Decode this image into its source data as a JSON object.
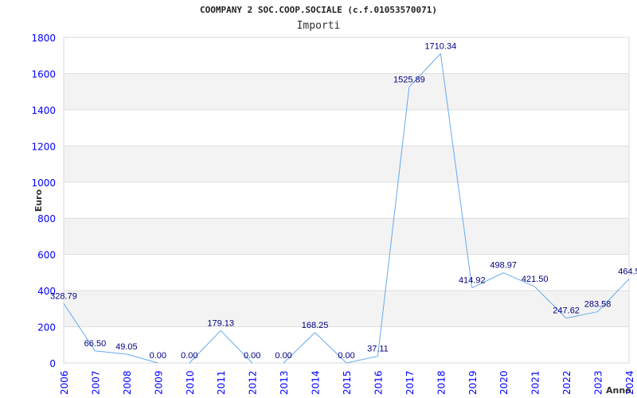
{
  "chart_data": {
    "type": "line",
    "title": "COOMPANY 2 SOC.COOP.SOCIALE (c.f.01053570071)",
    "subtitle": "Importi",
    "xlabel": "Anno",
    "ylabel": "Euro",
    "ylim": [
      0,
      1800
    ],
    "yticks": [
      0,
      200,
      400,
      600,
      800,
      1000,
      1200,
      1400,
      1600,
      1800
    ],
    "grid": true,
    "categories": [
      "2006",
      "2007",
      "2008",
      "2009",
      "2010",
      "2011",
      "2012",
      "2013",
      "2014",
      "2015",
      "2016",
      "2017",
      "2018",
      "2019",
      "2020",
      "2021",
      "2022",
      "2023",
      "2024"
    ],
    "values": [
      328.79,
      66.5,
      49.05,
      0.0,
      0.0,
      179.13,
      0.0,
      0.0,
      168.25,
      0.0,
      37.11,
      1525.89,
      1710.34,
      414.92,
      498.97,
      421.5,
      247.62,
      283.58,
      464.5
    ],
    "data_labels": [
      "328.79",
      "66.50",
      "49.05",
      "0.00",
      "0.00",
      "179.13",
      "0.00",
      "0.00",
      "168.25",
      "0.00",
      "37.11",
      "1525.89",
      "1710.34",
      "414.92",
      "498.97",
      "421.50",
      "247.62",
      "283.58",
      "464.5"
    ],
    "colors": {
      "line": "#66aaee",
      "tick_labels": "#0000ff",
      "data_labels": "#000080",
      "band": "#f3f3f3",
      "grid": "#dddddd"
    }
  }
}
